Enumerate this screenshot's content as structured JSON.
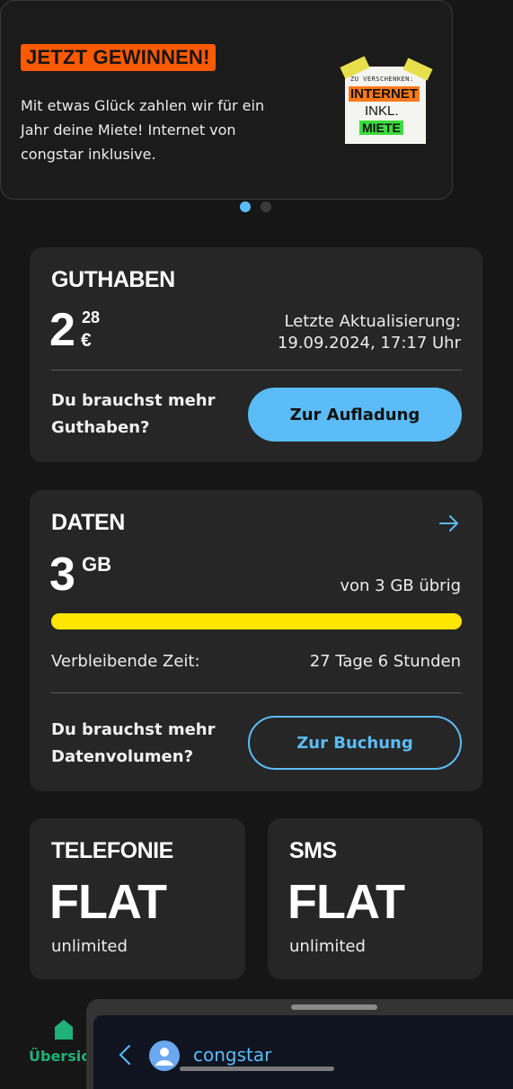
{
  "promo": {
    "badge": "JETZT GEWINNEN!",
    "text": "Mit etwas Glück zahlen wir für ein Jahr deine Miete! Internet von congstar inklusive.",
    "image": {
      "line1": "ZU VERSCHENKEN:",
      "line2": "INTERNET",
      "line3": "INKL.",
      "line4": "MIETE"
    }
  },
  "carousel": {
    "active_index": 0,
    "count": 2
  },
  "guthaben": {
    "title": "GUTHABEN",
    "amount_main": "2",
    "amount_cents": "28",
    "currency": "€",
    "update_label": "Letzte Aktualisierung:",
    "update_time": "19.09.2024, 17:17 Uhr",
    "prompt_line1": "Du brauchst mehr",
    "prompt_line2": "Guthaben?",
    "button": "Zur Aufladung"
  },
  "daten": {
    "title": "DATEN",
    "amount": "3",
    "unit": "GB",
    "remaining": "von 3 GB übrig",
    "progress_fraction": 1.0,
    "time_label": "Verbleibende Zeit:",
    "time_value": "27 Tage 6 Stunden",
    "prompt_line1": "Du brauchst mehr",
    "prompt_line2": "Datenvolumen?",
    "button": "Zur Buchung"
  },
  "telefonie": {
    "title": "TELEFONIE",
    "value": "FLAT",
    "sub": "unlimited"
  },
  "sms": {
    "title": "SMS",
    "value": "FLAT",
    "sub": "unlimited"
  },
  "bottom_nav": {
    "home_label": "Übersic"
  },
  "overlay": {
    "app_name": "congstar"
  },
  "colors": {
    "accent_blue": "#5bbcf7",
    "progress_yellow": "#ffe600",
    "promo_orange": "#ff5a00",
    "nav_green": "#20b07a",
    "card_bg": "#262626",
    "page_bg": "#161616"
  }
}
